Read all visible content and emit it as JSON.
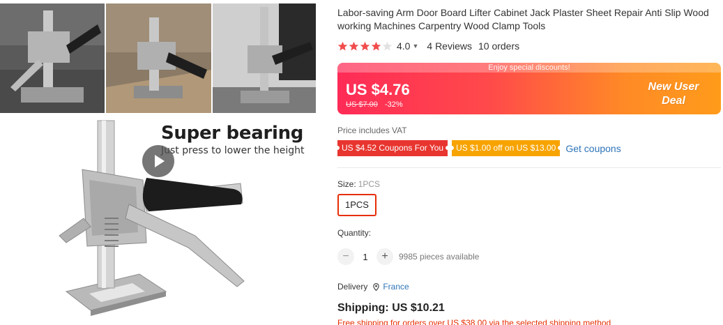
{
  "gallery": {
    "headline": "Super bearing",
    "subline": "Just press to lower the height"
  },
  "product": {
    "title": "Labor-saving Arm Door Board Lifter Cabinet Jack Plaster Sheet Repair Anti Slip Wood working Machines Carpentry Wood Clamp Tools",
    "rating": {
      "value": "4.0",
      "stars": 4,
      "max_stars": 5
    },
    "reviews": "4 Reviews",
    "orders": "10 orders"
  },
  "deal": {
    "strip_text": "Enjoy special discounts!",
    "price": "US $4.76",
    "old_price": "US $7.00",
    "discount": "-32%",
    "badge_line1": "New User",
    "badge_line2": "Deal"
  },
  "vat_note": "Price includes VAT",
  "coupons": {
    "coupon1": "US $4.52 Coupons For You",
    "coupon2": "US $1.00 off on US $13.00",
    "link": "Get coupons"
  },
  "size": {
    "label": "Size:",
    "selected": "1PCS",
    "option": "1PCS"
  },
  "quantity": {
    "label": "Quantity:",
    "minus": "−",
    "plus": "+",
    "value": "1",
    "available": "9985 pieces available"
  },
  "delivery": {
    "label": "Delivery",
    "country": "France"
  },
  "shipping": {
    "text": "Shipping: US $10.21",
    "note": "Free shipping for orders over US $38.00 via the selected shipping method"
  },
  "colors": {
    "accent": "#e62e04",
    "star": "#f14c4c",
    "link": "#2e74b8",
    "deal_start": "#ff2b57",
    "deal_end": "#ff9b1a",
    "coupon_red": "#e8352f",
    "coupon_orange": "#f7a300"
  },
  "icons": [
    "play-icon",
    "star-icon",
    "chevron-down-icon",
    "location-pin-icon"
  ]
}
